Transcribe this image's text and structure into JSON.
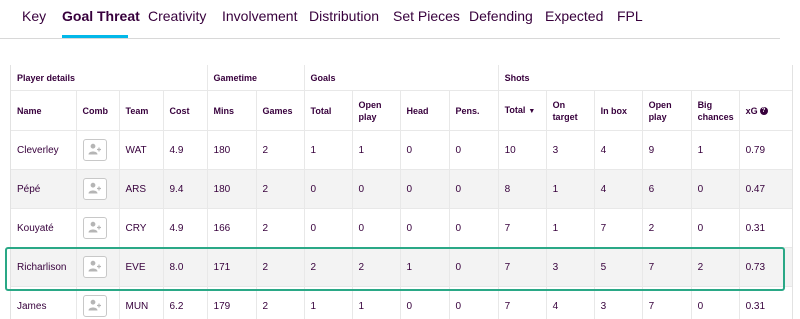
{
  "tabs": [
    "Key",
    "Goal Threat",
    "Creativity",
    "Involvement",
    "Distribution",
    "Set Pieces",
    "Defending",
    "Expected",
    "FPL"
  ],
  "active_tab": "Goal Threat",
  "accent_color": "#02b8e9",
  "highlight_color": "#2aa886",
  "table": {
    "groups": {
      "player": "Player details",
      "gametime": "Gametime",
      "goals": "Goals",
      "shots": "Shots"
    },
    "columns": [
      "Name",
      "Comb",
      "Team",
      "Cost",
      "Mins",
      "Games",
      "Total",
      "Open play",
      "Head",
      "Pens.",
      "Total",
      "On target",
      "In box",
      "Open play",
      "Big chances",
      "xG"
    ],
    "sorted_column_icon": "sort-down-icon",
    "info_icon": "help-circle-icon",
    "rows": [
      {
        "name": "Cleverley",
        "team": "WAT",
        "cost": "4.9",
        "mins": "180",
        "games": "2",
        "g_total": "1",
        "g_open": "1",
        "head": "0",
        "pens": "0",
        "s_total": "10",
        "on_target": "3",
        "in_box": "4",
        "s_open": "9",
        "big_chances": "1",
        "xg": "0.79"
      },
      {
        "name": "Pépé",
        "team": "ARS",
        "cost": "9.4",
        "mins": "180",
        "games": "2",
        "g_total": "0",
        "g_open": "0",
        "head": "0",
        "pens": "0",
        "s_total": "8",
        "on_target": "1",
        "in_box": "4",
        "s_open": "6",
        "big_chances": "0",
        "xg": "0.47"
      },
      {
        "name": "Kouyaté",
        "team": "CRY",
        "cost": "4.9",
        "mins": "166",
        "games": "2",
        "g_total": "0",
        "g_open": "0",
        "head": "0",
        "pens": "0",
        "s_total": "7",
        "on_target": "1",
        "in_box": "7",
        "s_open": "2",
        "big_chances": "0",
        "xg": "0.31"
      },
      {
        "name": "Richarlison",
        "team": "EVE",
        "cost": "8.0",
        "mins": "171",
        "games": "2",
        "g_total": "2",
        "g_open": "2",
        "head": "1",
        "pens": "0",
        "s_total": "7",
        "on_target": "3",
        "in_box": "5",
        "s_open": "7",
        "big_chances": "2",
        "xg": "0.73"
      },
      {
        "name": "James",
        "team": "MUN",
        "cost": "6.2",
        "mins": "179",
        "games": "2",
        "g_total": "1",
        "g_open": "1",
        "head": "0",
        "pens": "0",
        "s_total": "7",
        "on_target": "4",
        "in_box": "3",
        "s_open": "7",
        "big_chances": "0",
        "xg": "0.31"
      }
    ]
  }
}
